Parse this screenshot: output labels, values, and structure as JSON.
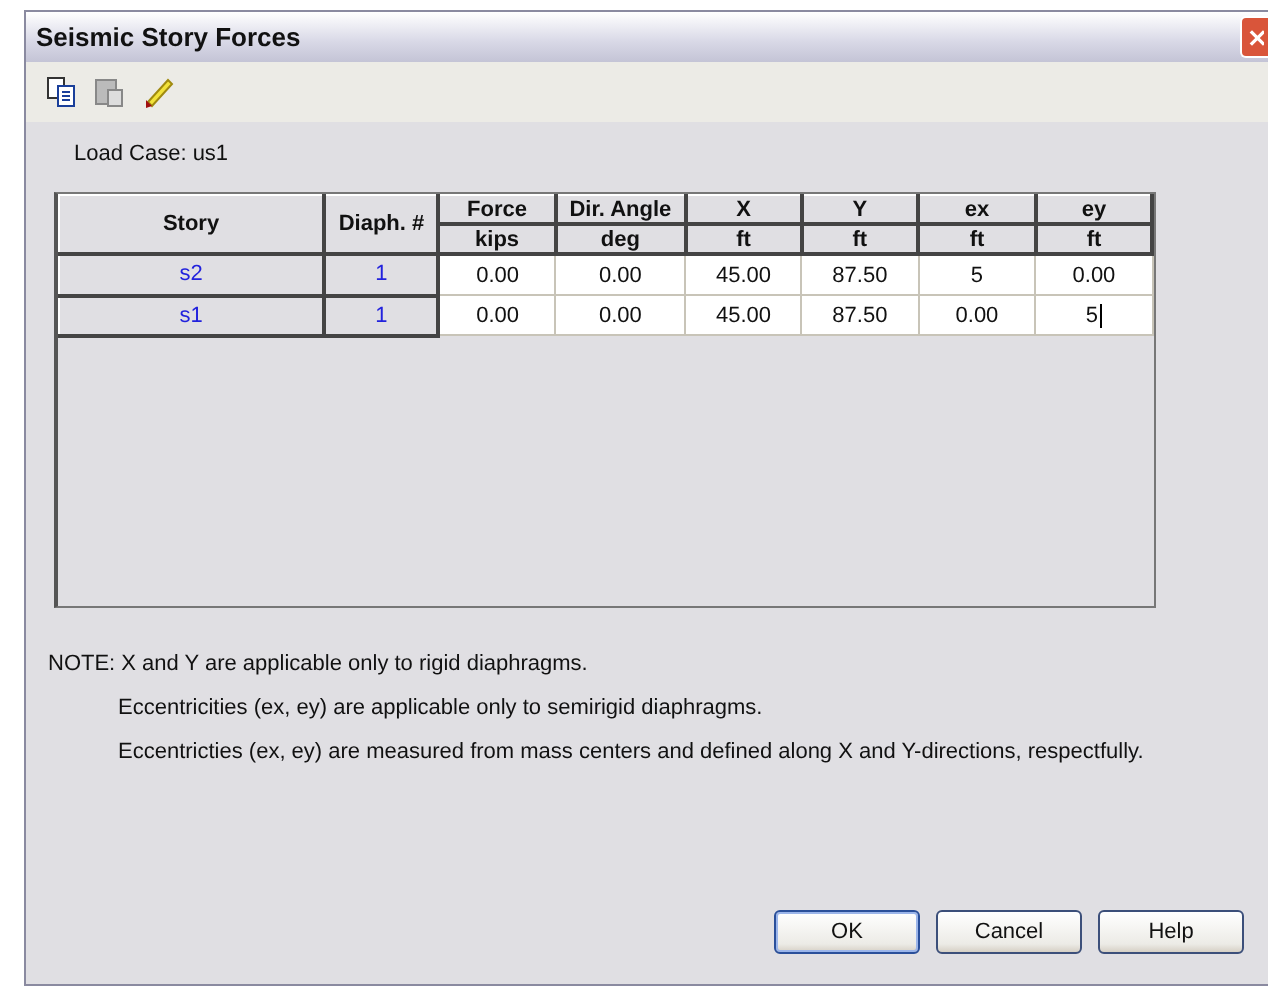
{
  "window": {
    "title": "Seismic Story Forces"
  },
  "load_case": "Load Case:  us1",
  "columns": [
    {
      "header": "Story"
    },
    {
      "header": "Diaph. #"
    },
    {
      "header": "Force",
      "unit": "kips"
    },
    {
      "header": "Dir. Angle",
      "unit": "deg"
    },
    {
      "header": "X",
      "unit": "ft"
    },
    {
      "header": "Y",
      "unit": "ft"
    },
    {
      "header": "ex",
      "unit": "ft"
    },
    {
      "header": "ey",
      "unit": "ft"
    }
  ],
  "rows": [
    {
      "story": "s2",
      "diaphragm": "1",
      "cells": [
        {
          "text": "0.00",
          "editing": false
        },
        {
          "text": "0.00",
          "editing": false
        },
        {
          "text": "45.00",
          "editing": false
        },
        {
          "text": "87.50",
          "editing": false
        },
        {
          "text": "5",
          "editing": false
        },
        {
          "text": "0.00",
          "editing": false
        }
      ]
    },
    {
      "story": "s1",
      "diaphragm": "1",
      "cells": [
        {
          "text": "0.00",
          "editing": false
        },
        {
          "text": "0.00",
          "editing": false
        },
        {
          "text": "45.00",
          "editing": false
        },
        {
          "text": "87.50",
          "editing": false
        },
        {
          "text": "0.00",
          "editing": false
        },
        {
          "text": "5",
          "editing": true
        }
      ]
    }
  ],
  "notes": [
    "NOTE: X and Y are applicable only to rigid diaphragms.",
    "Eccentricities (ex, ey) are applicable only to semirigid diaphragms.",
    "Eccentricties (ex, ey) are measured from mass centers and defined along X and Y-directions, respectfully."
  ],
  "buttons": [
    {
      "label": "OK",
      "default": true
    },
    {
      "label": "Cancel",
      "default": false
    },
    {
      "label": "Help",
      "default": false
    }
  ]
}
